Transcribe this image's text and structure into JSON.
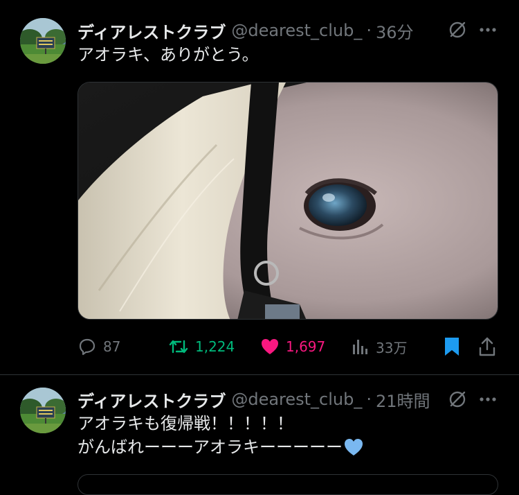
{
  "tweets": [
    {
      "name": "ディアレストクラブ",
      "handle": "@dearest_club_",
      "separator": "·",
      "time": "36分",
      "lines": [
        "アオラキ、ありがとう。"
      ],
      "actions": {
        "replies": "87",
        "retweets": "1,224",
        "likes": "1,697",
        "views": "33万"
      },
      "liked": true,
      "bookmarked": true
    },
    {
      "name": "ディアレストクラブ",
      "handle": "@dearest_club_",
      "separator": "·",
      "time": "21時間",
      "lines": [
        "アオラキも復帰戦！！！！！",
        "がんばれーーーアオラキーーーーー"
      ],
      "emoji": "blue-heart"
    }
  ],
  "colors": {
    "background": "#000000",
    "text": "#e7e9ea",
    "muted": "#71767b",
    "retweet": "#00ba7c",
    "like": "#f91880",
    "bookmark": "#1d9bf0",
    "divider": "#2f3336"
  },
  "icons": [
    "grok-icon",
    "more-icon",
    "reply-icon",
    "retweet-icon",
    "heart-icon",
    "views-icon",
    "bookmark-icon",
    "share-icon",
    "blue-heart-emoji"
  ]
}
